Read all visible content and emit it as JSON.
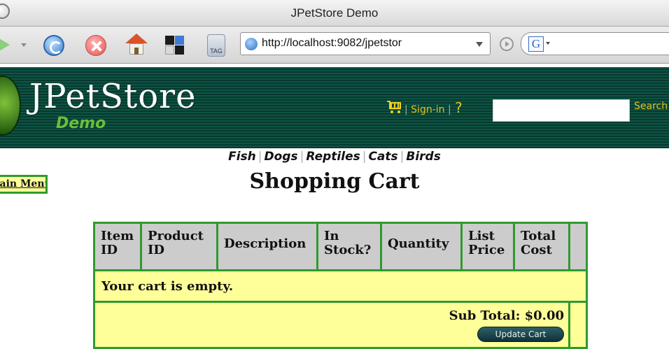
{
  "browser": {
    "window_title": "JPetStore Demo",
    "url": "http://localhost:9082/jpetstor",
    "tag_label": "TAG",
    "search_engine_letter": "G"
  },
  "header": {
    "brand": "JPetStore",
    "subbrand": "Demo",
    "signin_label": "Sign-in",
    "help_label": "?",
    "search_value": "",
    "search_link": "Search"
  },
  "categories": [
    "Fish",
    "Dogs",
    "Reptiles",
    "Cats",
    "Birds"
  ],
  "main_menu_label": "Main Menu",
  "page_title": "Shopping Cart",
  "cart": {
    "columns": [
      "Item ID",
      "Product ID",
      "Description",
      "In Stock?",
      "Quantity",
      "List Price",
      "Total Cost"
    ],
    "empty_message": "Your cart is empty.",
    "subtotal_label": "Sub Total:",
    "subtotal_value": "$0.00",
    "update_button_label": "Update Cart"
  },
  "colors": {
    "banner_green": "#0c4a3d",
    "table_border": "#2f9a2f",
    "table_fill": "#ffff99",
    "header_cell": "#cccccc",
    "link_yellow": "#e3c31a"
  }
}
